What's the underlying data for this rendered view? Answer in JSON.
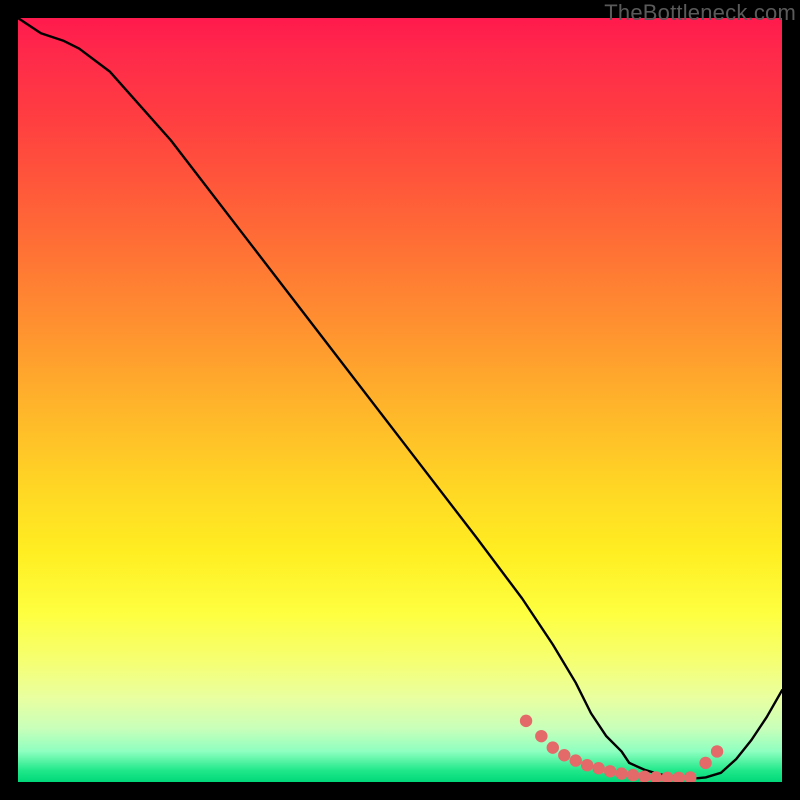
{
  "attribution": "TheBottleneck.com",
  "chart_data": {
    "type": "line",
    "title": "",
    "xlabel": "",
    "ylabel": "",
    "xlim": [
      0,
      100
    ],
    "ylim": [
      0,
      100
    ],
    "grid": false,
    "legend": false,
    "series": [
      {
        "name": "bottleneck-curve",
        "color": "#000000",
        "x": [
          0,
          3,
          6,
          8,
          12,
          20,
          30,
          40,
          50,
          60,
          66,
          70,
          73,
          75,
          77,
          79,
          80,
          82,
          84,
          86,
          88,
          89,
          90,
          92,
          94,
          96,
          98,
          100
        ],
        "y": [
          100,
          98,
          97,
          96,
          93,
          84,
          71,
          58,
          45,
          32,
          24,
          18,
          13,
          9,
          6,
          4,
          2.5,
          1.6,
          1.0,
          0.7,
          0.5,
          0.5,
          0.6,
          1.2,
          3.0,
          5.5,
          8.5,
          12
        ]
      }
    ],
    "markers": {
      "color": "#e46a6a",
      "x": [
        66.5,
        68.5,
        70.0,
        71.5,
        73.0,
        74.5,
        76.0,
        77.5,
        79.0,
        80.5,
        82.0,
        83.5,
        85.0,
        86.5,
        88.0,
        90.0,
        91.5
      ],
      "y": [
        8.0,
        6.0,
        4.5,
        3.5,
        2.8,
        2.2,
        1.8,
        1.4,
        1.1,
        0.9,
        0.7,
        0.6,
        0.55,
        0.55,
        0.6,
        2.5,
        4.0
      ]
    },
    "gradient_stops": [
      {
        "pos": 0.0,
        "color": "#ff1a4d"
      },
      {
        "pos": 0.28,
        "color": "#ff6a36"
      },
      {
        "pos": 0.62,
        "color": "#ffd824"
      },
      {
        "pos": 0.84,
        "color": "#f6ff70"
      },
      {
        "pos": 0.98,
        "color": "#20e88a"
      },
      {
        "pos": 1.0,
        "color": "#00d879"
      }
    ]
  }
}
